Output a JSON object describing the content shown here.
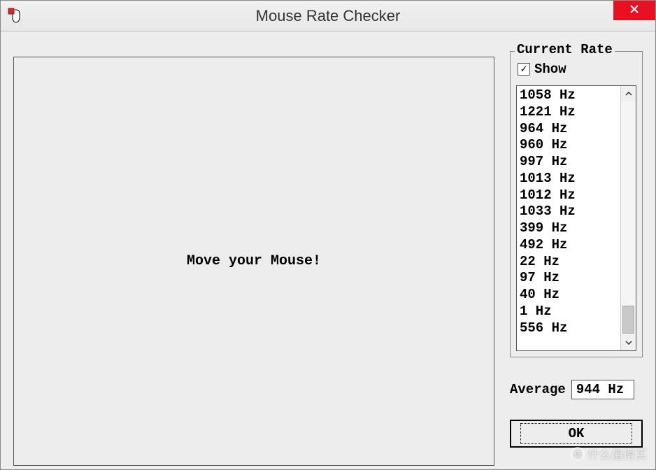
{
  "window": {
    "title": "Mouse Rate Checker"
  },
  "main": {
    "instruction": "Move your Mouse!"
  },
  "currentRate": {
    "groupTitle": "Current Rate",
    "showLabel": "Show",
    "showChecked": "✓",
    "items": [
      "1058 Hz",
      "1221 Hz",
      "964 Hz",
      "960 Hz",
      "997 Hz",
      "1013 Hz",
      "1012 Hz",
      "1033 Hz",
      "399 Hz",
      "492 Hz",
      "22 Hz",
      "97 Hz",
      "40 Hz",
      "1 Hz",
      "556 Hz"
    ]
  },
  "average": {
    "label": "Average",
    "value": "944 Hz"
  },
  "buttons": {
    "ok": "OK"
  },
  "watermark": {
    "text": "什么值得买"
  }
}
